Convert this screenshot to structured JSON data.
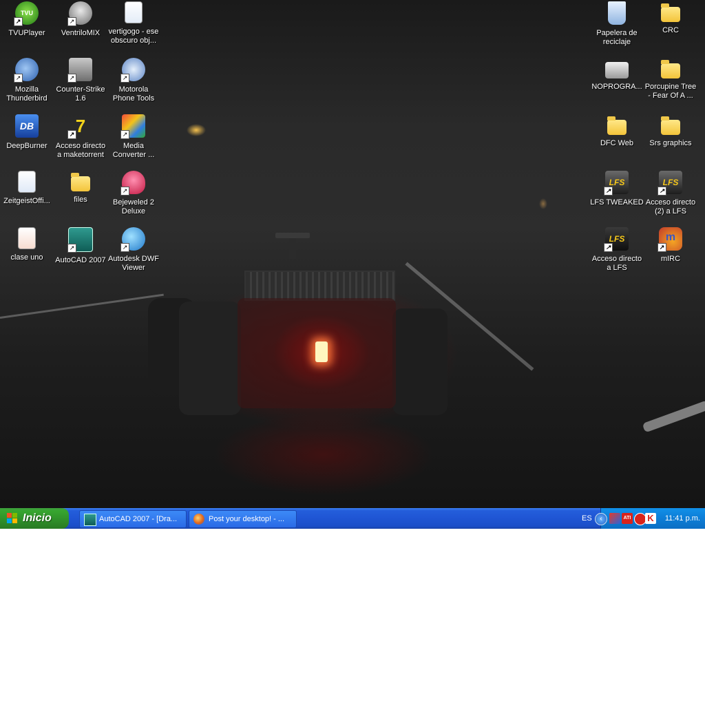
{
  "desktop": {
    "icons": [
      {
        "label": "TVUPlayer",
        "icon": "tvuplayer-icon",
        "shortcut": true
      },
      {
        "label": "VentriloMIX",
        "icon": "ventrilo-icon",
        "shortcut": true
      },
      {
        "label": "vertigogo - ese\nobscuro obj...",
        "icon": "document-icon",
        "shortcut": false
      },
      {
        "label": "Mozilla\nThunderbird",
        "icon": "thunderbird-icon",
        "shortcut": true
      },
      {
        "label": "Counter-Strike\n1.6",
        "icon": "counter-strike-icon",
        "shortcut": true
      },
      {
        "label": "Motorola\nPhone Tools",
        "icon": "motorola-icon",
        "shortcut": true
      },
      {
        "label": "DeepBurner",
        "icon": "deepburner-icon",
        "shortcut": false
      },
      {
        "label": "Acceso directo\na maketorrent",
        "icon": "maketorrent-icon",
        "shortcut": true
      },
      {
        "label": "Media\nConverter ...",
        "icon": "media-converter-icon",
        "shortcut": true
      },
      {
        "label": "ZeitgeistOffi...",
        "icon": "document-icon",
        "shortcut": false
      },
      {
        "label": "files",
        "icon": "folder-icon",
        "shortcut": false
      },
      {
        "label": "Bejeweled 2\nDeluxe",
        "icon": "bejeweled-icon",
        "shortcut": true
      },
      {
        "label": "clase uno",
        "icon": "powerpoint-icon",
        "shortcut": false
      },
      {
        "label": "AutoCAD 2007",
        "icon": "autocad-icon",
        "shortcut": true
      },
      {
        "label": "Autodesk DWF\nViewer",
        "icon": "dwf-viewer-icon",
        "shortcut": true
      },
      {
        "label": "Papelera de\nreciclaje",
        "icon": "recycle-bin-icon",
        "shortcut": false
      },
      {
        "label": "CRC",
        "icon": "folder-icon",
        "shortcut": false
      },
      {
        "label": "NOPROGRA...",
        "icon": "drive-icon",
        "shortcut": false
      },
      {
        "label": "Porcupine Tree\n- Fear Of A ...",
        "icon": "folder-icon",
        "shortcut": false
      },
      {
        "label": "DFC Web",
        "icon": "folder-icon",
        "shortcut": false
      },
      {
        "label": "Srs graphics",
        "icon": "folder-icon",
        "shortcut": false
      },
      {
        "label": "LFS TWEAKED",
        "icon": "lfs-icon",
        "shortcut": true
      },
      {
        "label": "Acceso directo\n(2) a LFS",
        "icon": "lfs-icon",
        "shortcut": true
      },
      {
        "label": "Acceso directo\na LFS",
        "icon": "lfs-icon",
        "shortcut": true
      },
      {
        "label": "mIRC",
        "icon": "mirc-icon",
        "shortcut": true
      }
    ]
  },
  "taskbar": {
    "start_label": "Inicio",
    "tasks": [
      {
        "label": "AutoCAD 2007 - [Dra...",
        "icon": "autocad-icon"
      },
      {
        "label": "Post your desktop! - ...",
        "icon": "firefox-icon"
      }
    ],
    "language": "ES",
    "tray_icons": [
      "chevron-left-icon",
      "msn-icon",
      "ati-icon",
      "flash-icon",
      "kaspersky-icon"
    ],
    "clock": "11:41 p.m."
  },
  "colors": {
    "taskbar_blue": "#245edb",
    "start_green": "#37a52f",
    "tray_blue": "#0d7dd6"
  }
}
